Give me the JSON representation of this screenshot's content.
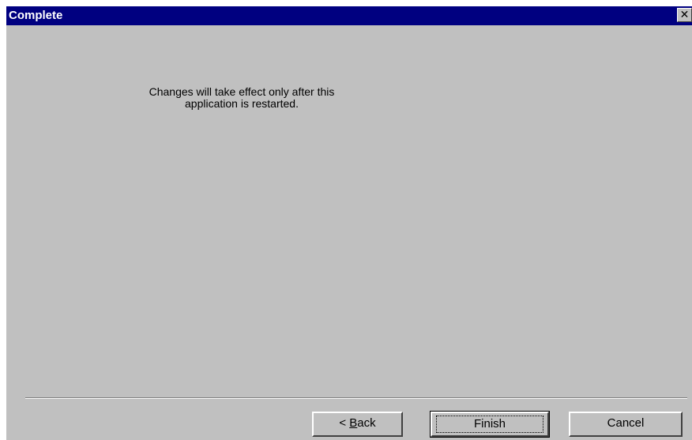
{
  "window": {
    "title": "Complete"
  },
  "message": {
    "line1": "Changes will take effect only after this",
    "line2": "application is restarted."
  },
  "buttons": {
    "back_prefix": "< ",
    "back_accel": "B",
    "back_rest": "ack",
    "finish": "Finish",
    "cancel": "Cancel"
  },
  "icons": {
    "close": "close-icon"
  },
  "colors": {
    "titlebar": "#000080",
    "face": "#c0c0c0"
  }
}
